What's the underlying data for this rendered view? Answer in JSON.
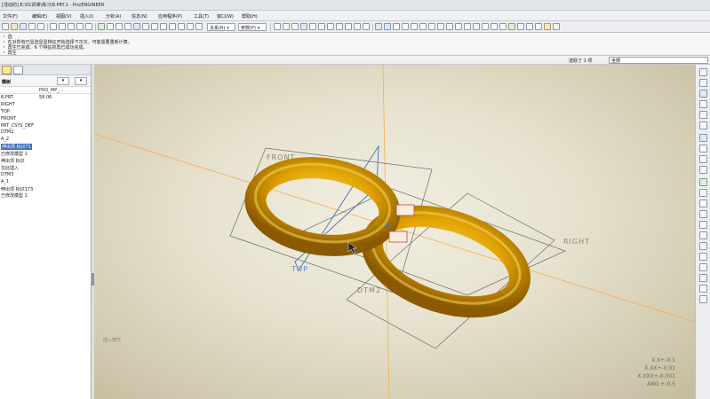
{
  "window": {
    "title": "[活动的] E:\\01讲课\\练习\\8.PRT.1 - Pro/ENGINEER"
  },
  "menu": [
    {
      "label": "文件(F)"
    },
    {
      "label": "编辑(E)"
    },
    {
      "label": "视图(V)"
    },
    {
      "label": "插入(I)"
    },
    {
      "label": "分析(A)"
    },
    {
      "label": "信息(N)"
    },
    {
      "label": "应用程序(P)"
    },
    {
      "label": "工具(T)"
    },
    {
      "label": "窗口(W)"
    },
    {
      "label": "帮助(H)"
    }
  ],
  "toolbar": {
    "relation_dropdown": "关系(R)",
    "param_dropdown": "参数(P)"
  },
  "messages": [
    "・ 选",
    "・ 在对所有已显选显显特征开始选择下次次。可能需要重新计算。",
    "・ 再生已完成：6 个特征的再已成功完成。",
    "・ 再生"
  ],
  "statusbar": {
    "selected": "选取了 1 项",
    "filter": "全部"
  },
  "nav": {
    "header": "模树",
    "column_header": "PRO_MP_...",
    "items": [
      {
        "label": "8.PRT",
        "value": "58.06"
      },
      {
        "label": "RIGHT",
        "value": ""
      },
      {
        "label": "TOP",
        "value": ""
      },
      {
        "label": "FRONT",
        "value": ""
      },
      {
        "label": "PRT_CSYS_DEF",
        "value": ""
      },
      {
        "label": "DTM2",
        "value": ""
      },
      {
        "label": "A_2",
        "value": ""
      },
      {
        "label": "伸出项 标识71",
        "value": "",
        "selected": true
      },
      {
        "label": "已修改模型 1",
        "value": ""
      },
      {
        "label": "伸出项 标识",
        "value": ""
      },
      {
        "label": "在此插入",
        "value": ""
      },
      {
        "label": "DTM3",
        "value": ""
      },
      {
        "label": "A_1",
        "value": ""
      },
      {
        "label": "伸出项 标识173",
        "value": ""
      },
      {
        "label": "已修改模型 1",
        "value": ""
      }
    ]
  },
  "viewport": {
    "datum_labels": {
      "front": "FRONT",
      "right": "RIGHT",
      "top": "TOP",
      "dtm2": "DTM2"
    },
    "note": "插入模式",
    "tolerances": [
      "X.X+-0.1",
      "X.XX+-0.01",
      "X.XXX+-0.001",
      "ANG +-0.5"
    ],
    "colors": {
      "torus": "#e0a200",
      "torus_highlight": "#f4c433",
      "torus_shadow": "#8b5a00",
      "datum_lines": "#6b6b6b",
      "axis_lines": "#f0b050",
      "blue_datum": "#4a6fb8"
    }
  }
}
